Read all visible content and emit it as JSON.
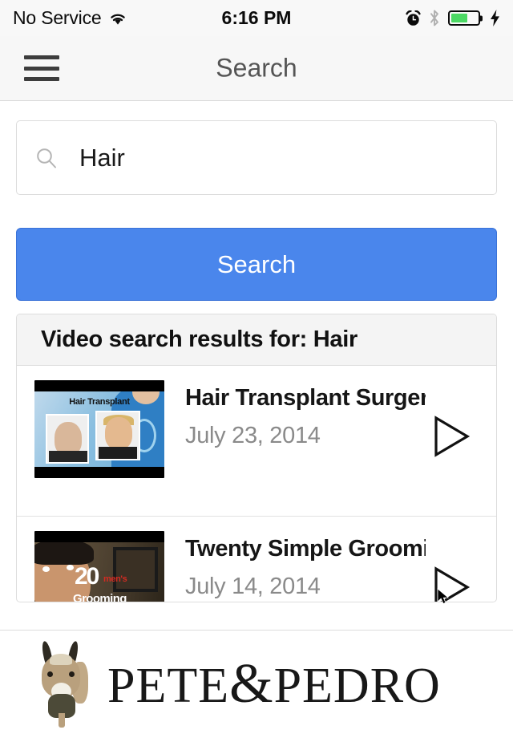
{
  "statusbar": {
    "carrier": "No Service",
    "time": "6:16 PM",
    "wifi_icon": "wifi-icon",
    "alarm_icon": "alarm-clock-icon",
    "bluetooth_icon": "bluetooth-icon",
    "battery_icon": "battery-icon",
    "battery_percent": 62,
    "charging_icon": "lightning-bolt-icon"
  },
  "navbar": {
    "menu_icon": "hamburger-menu-icon",
    "title": "Search"
  },
  "search": {
    "icon": "magnifier-icon",
    "value": "Hair",
    "placeholder": "Search",
    "button_label": "Search",
    "button_color": "#4a86ec"
  },
  "results": {
    "header": "Video search results for: Hair",
    "items": [
      {
        "title": "Hair Transplant Surgery...",
        "date": "July 23, 2014",
        "thumbnail_label": "Hair Transplant",
        "play_icon": "play-triangle-icon"
      },
      {
        "title": "Twenty Simple Groomi...",
        "date": "July 14, 2014",
        "thumbnail_number": "20",
        "thumbnail_mens": "men's",
        "thumbnail_grooming": "Grooming",
        "play_icon": "play-triangle-icon"
      }
    ]
  },
  "footer": {
    "logo_icon": "donkey-icon",
    "brand_first": "PETE",
    "brand_amp": "&",
    "brand_second": "PEDRO"
  },
  "cursor": {
    "icon": "mouse-pointer-icon"
  }
}
